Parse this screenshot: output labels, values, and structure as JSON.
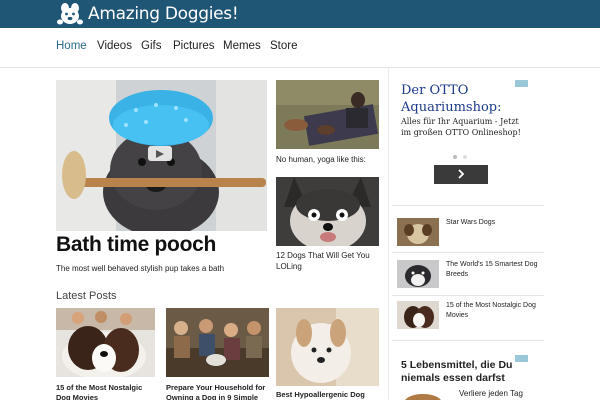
{
  "header": {
    "logo_text": "Amazing Doggies!",
    "bar_color": "#1f5575"
  },
  "nav": {
    "items": [
      {
        "label": "Home",
        "active": true
      },
      {
        "label": "Videos"
      },
      {
        "label": "Gifs"
      },
      {
        "label": "Pictures"
      },
      {
        "label": "Memes"
      },
      {
        "label": "Store"
      }
    ],
    "active_color": "#2a6a8c"
  },
  "hero": {
    "title": "Bath time pooch",
    "subtitle": "The most well behaved stylish pup takes a bath",
    "play_icon": "play-icon"
  },
  "featured": [
    {
      "caption": "No human, yoga like this:"
    },
    {
      "caption": "12 Dogs That Will Get You LOLing"
    }
  ],
  "latest": {
    "heading": "Latest Posts",
    "posts": [
      {
        "title": "15 of the Most Nostalgic Dog Movies"
      },
      {
        "title": "Prepare Your Household for Owning a Dog in 9 Simple"
      },
      {
        "title": "Best Hypoallergenic Dog"
      }
    ]
  },
  "ad_top": {
    "title": "Der OTTO Aquariumshop:",
    "body": "Alles für Ihr Aquarium - Jetzt im großen OTTO Onlineshop!",
    "next_icon": "chevron-right-icon",
    "dots": 2
  },
  "sidebar": {
    "items": [
      {
        "text": "Star Wars Dogs"
      },
      {
        "text": "The World's 15 Smartest Dog Breeds"
      },
      {
        "text": "15 of the Most Nostalgic Dog Movies"
      }
    ]
  },
  "ad_bottom": {
    "title": "5 Lebensmittel, die Du niemals essen darfst",
    "subtitle": "Verliere jeden Tag"
  }
}
